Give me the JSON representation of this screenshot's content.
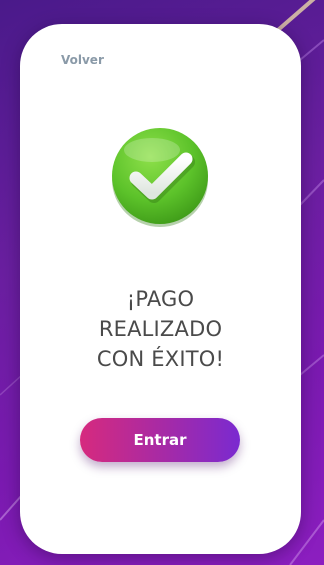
{
  "nav": {
    "back_label": "Volver"
  },
  "status": {
    "icon": "check-circle-icon",
    "line1": "¡PAGO",
    "line2": "REALIZADO",
    "line3": "CON ÉXITO!"
  },
  "actions": {
    "enter_label": "Entrar"
  },
  "colors": {
    "background_start": "#4a1a8a",
    "background_end": "#8c1ec0",
    "card": "#ffffff",
    "check_green": "#5cc22a",
    "button_start": "#d62a7e",
    "button_end": "#7a2ad0",
    "text": "#4a4a4a",
    "link": "#8a9aa8"
  }
}
